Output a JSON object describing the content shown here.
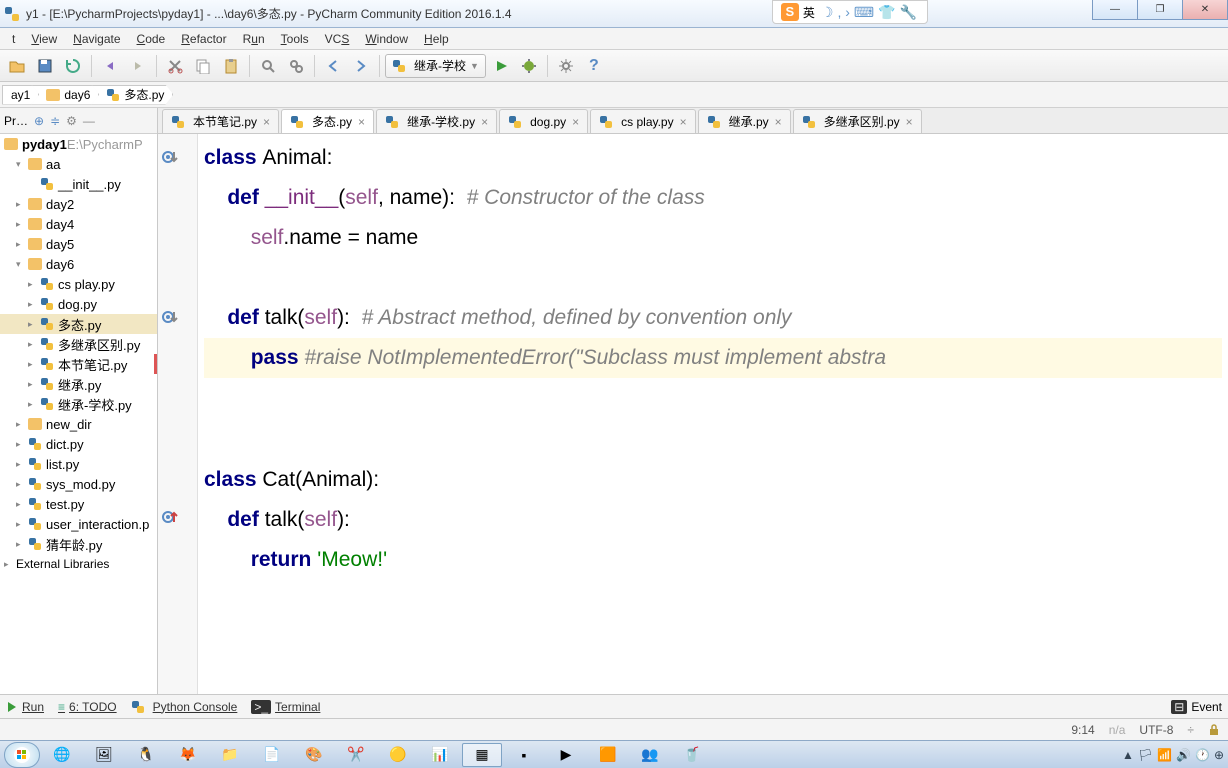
{
  "title": "y1 - [E:\\PycharmProjects\\pyday1] - ...\\day6\\多态.py - PyCharm Community Edition 2016.1.4",
  "sogou_label": "英",
  "menu": {
    "file": "t",
    "view": "View",
    "navigate": "Navigate",
    "code": "Code",
    "refactor": "Refactor",
    "run": "Run",
    "tools": "Tools",
    "vcs": "VCS",
    "window": "Window",
    "help": "Help"
  },
  "run_config": "继承-学校",
  "breadcrumbs": [
    "ay1",
    "day6",
    "多态.py"
  ],
  "sidebar_header": {
    "pr": "Pr…",
    "title": "pyday1",
    "path": "E:\\PycharmP"
  },
  "tree": [
    {
      "indent": 0,
      "icon": "folder",
      "label": "aa",
      "arrow": "▾"
    },
    {
      "indent": 1,
      "icon": "py",
      "label": "__init__.py"
    },
    {
      "indent": 0,
      "icon": "folder",
      "label": "day2",
      "arrow": "▸"
    },
    {
      "indent": 0,
      "icon": "folder",
      "label": "day4",
      "arrow": "▸"
    },
    {
      "indent": 0,
      "icon": "folder",
      "label": "day5",
      "arrow": "▸"
    },
    {
      "indent": 0,
      "icon": "folder",
      "label": "day6",
      "arrow": "▾"
    },
    {
      "indent": 1,
      "icon": "py",
      "label": "cs play.py",
      "arrow": "▸"
    },
    {
      "indent": 1,
      "icon": "py",
      "label": "dog.py",
      "arrow": "▸"
    },
    {
      "indent": 1,
      "icon": "py",
      "label": "多态.py",
      "arrow": "▸",
      "selected": true
    },
    {
      "indent": 1,
      "icon": "py",
      "label": "多继承区别.py",
      "arrow": "▸"
    },
    {
      "indent": 1,
      "icon": "py",
      "label": "本节笔记.py",
      "arrow": "▸",
      "redline": true
    },
    {
      "indent": 1,
      "icon": "py",
      "label": "继承.py",
      "arrow": "▸"
    },
    {
      "indent": 1,
      "icon": "py",
      "label": "继承-学校.py",
      "arrow": "▸"
    },
    {
      "indent": 0,
      "icon": "folder",
      "label": "new_dir",
      "arrow": "▸"
    },
    {
      "indent": 0,
      "icon": "py",
      "label": "dict.py",
      "arrow": "▸"
    },
    {
      "indent": 0,
      "icon": "py",
      "label": "list.py",
      "arrow": "▸"
    },
    {
      "indent": 0,
      "icon": "py",
      "label": "sys_mod.py",
      "arrow": "▸"
    },
    {
      "indent": 0,
      "icon": "py",
      "label": "test.py",
      "arrow": "▸"
    },
    {
      "indent": 0,
      "icon": "py",
      "label": "user_interaction.p",
      "arrow": "▸"
    },
    {
      "indent": 0,
      "icon": "py",
      "label": "猜年龄.py",
      "arrow": "▸"
    }
  ],
  "external_libs": "External Libraries",
  "editor_tabs": [
    {
      "label": "本节笔记.py",
      "close": true
    },
    {
      "label": "多态.py",
      "close": true,
      "active": true
    },
    {
      "label": "继承-学校.py",
      "close": true
    },
    {
      "label": "dog.py",
      "close": true
    },
    {
      "label": "cs play.py",
      "close": true
    },
    {
      "label": "继承.py",
      "close": true
    },
    {
      "label": "多继承区别.py",
      "close": true
    }
  ],
  "code_lines": [
    {
      "tokens": [
        {
          "t": "class ",
          "c": "kw"
        },
        {
          "t": "Animal:"
        }
      ]
    },
    {
      "tokens": [
        {
          "t": "    "
        },
        {
          "t": "def ",
          "c": "kw"
        },
        {
          "t": "__init__",
          "c": "fn"
        },
        {
          "t": "("
        },
        {
          "t": "self",
          "c": "self"
        },
        {
          "t": ", name):  "
        },
        {
          "t": "# Constructor of the class",
          "c": "cmt"
        }
      ]
    },
    {
      "tokens": [
        {
          "t": "        "
        },
        {
          "t": "self",
          "c": "self"
        },
        {
          "t": ".name = name"
        }
      ]
    },
    {
      "tokens": [
        {
          "t": ""
        }
      ]
    },
    {
      "tokens": [
        {
          "t": "    "
        },
        {
          "t": "def ",
          "c": "kw"
        },
        {
          "t": "talk("
        },
        {
          "t": "self",
          "c": "self"
        },
        {
          "t": "):  "
        },
        {
          "t": "# Abstract method, defined by convention only",
          "c": "cmt"
        }
      ]
    },
    {
      "hl": true,
      "tokens": [
        {
          "t": "        "
        },
        {
          "t": "pass ",
          "c": "kw"
        },
        {
          "t": "#raise NotImplementedError(\"Subclass must implement abstra",
          "c": "cmt"
        }
      ]
    },
    {
      "tokens": [
        {
          "t": ""
        }
      ]
    },
    {
      "tokens": [
        {
          "t": ""
        }
      ]
    },
    {
      "tokens": [
        {
          "t": "class ",
          "c": "kw"
        },
        {
          "t": "Cat(Animal):"
        }
      ]
    },
    {
      "tokens": [
        {
          "t": "    "
        },
        {
          "t": "def ",
          "c": "kw"
        },
        {
          "t": "talk("
        },
        {
          "t": "self",
          "c": "self"
        },
        {
          "t": "):"
        }
      ]
    },
    {
      "tokens": [
        {
          "t": "        "
        },
        {
          "t": "return ",
          "c": "kw"
        },
        {
          "t": "'Meow!'",
          "c": "str"
        }
      ]
    }
  ],
  "gutter_markers": [
    {
      "line": 0,
      "type": "override-down"
    },
    {
      "line": 4,
      "type": "override-down"
    },
    {
      "line": 9,
      "type": "override-up"
    }
  ],
  "bottom_tools": {
    "run": "Run",
    "todo": "6: TODO",
    "console": "Python Console",
    "terminal": "Terminal",
    "event_log": "Event"
  },
  "status": {
    "pos": "9:14",
    "insert": "n/a",
    "encoding": "UTF-8"
  }
}
